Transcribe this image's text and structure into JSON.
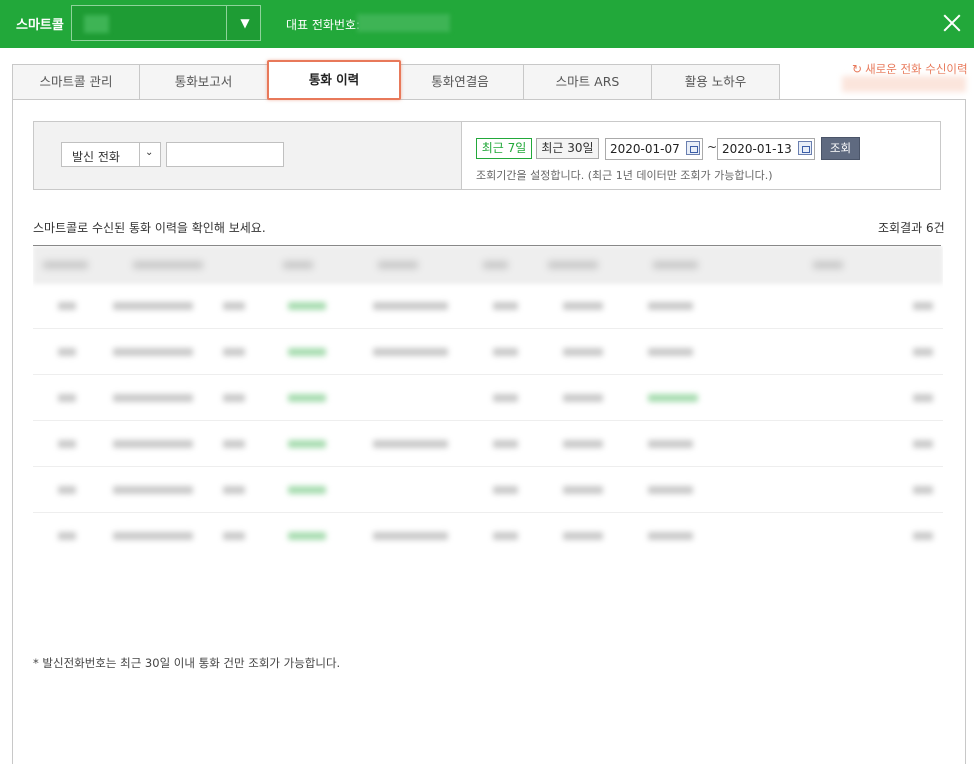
{
  "header": {
    "brand": "스마트콜",
    "rep_phone_label": "대표 전화번호:",
    "background_color": "#22a83a"
  },
  "tabs": [
    {
      "label": "스마트콜 관리",
      "active": false
    },
    {
      "label": "통화보고서",
      "active": false
    },
    {
      "label": "통화 이력",
      "active": true
    },
    {
      "label": "통화연결음",
      "active": false
    },
    {
      "label": "스마트 ARS",
      "active": false
    },
    {
      "label": "활용 노하우",
      "active": false
    }
  ],
  "new_history_link": {
    "icon": "refresh-icon",
    "label": "새로운 전화 수신이력",
    "color": "#e8795a"
  },
  "search": {
    "caller_select": "발신 전화",
    "caller_input_value": "",
    "period_7": "최근 7일",
    "period_30": "최근 30일",
    "start_date": "2020-01-07",
    "end_date": "2020-01-13",
    "tilde": "~",
    "search_button": "조회",
    "period_note": "조회기간을 설정합니다. (최근 1년 데이터만 조회가 가능합니다.)"
  },
  "results": {
    "intro": "스마트콜로 수신된 통화 이력을 확인해 보세요.",
    "count": "조회결과 6건"
  },
  "footer_note": "* 발신전화번호는 최근 30일 이내 통화 건만 조회가 가능합니다."
}
